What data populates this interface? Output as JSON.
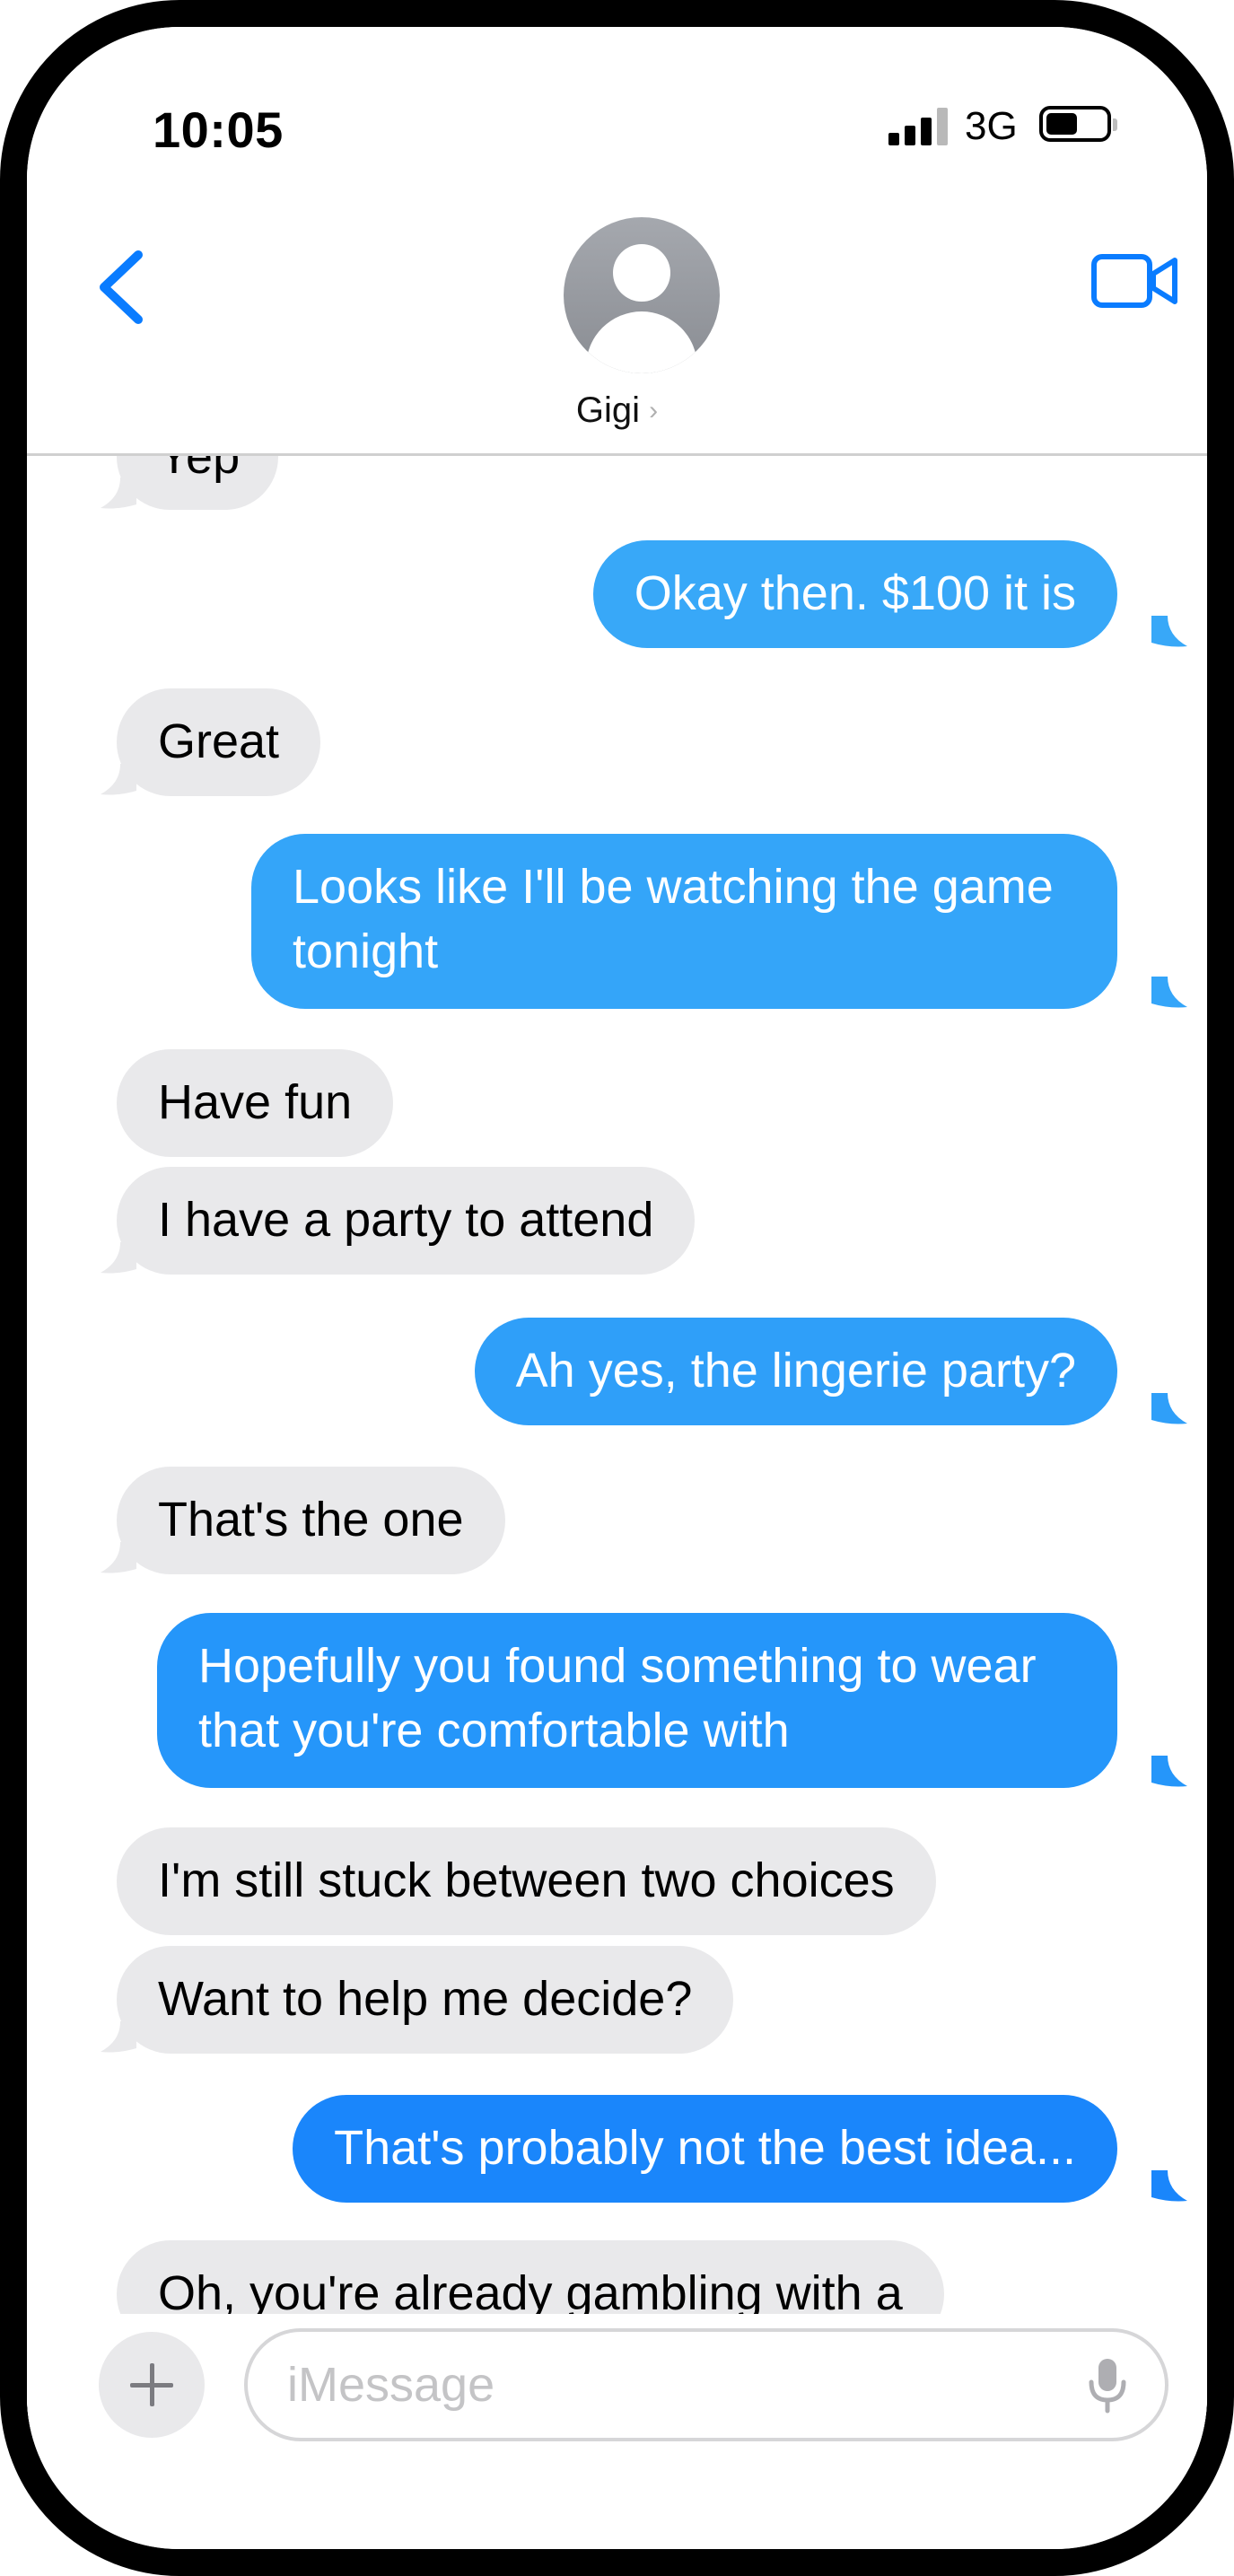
{
  "status_bar": {
    "time": "10:05",
    "network": "3G"
  },
  "header": {
    "contact_name": "Gigi",
    "icons": {
      "back": "chevron-left-icon",
      "avatar": "person-avatar-icon",
      "video": "video-camera-icon",
      "name_chevron": "chevron-right-icon"
    }
  },
  "messages": [
    {
      "sender": "them",
      "text": "Yep"
    },
    {
      "sender": "me",
      "text": "Okay then.  $100 it is"
    },
    {
      "sender": "them",
      "text": "Great"
    },
    {
      "sender": "me",
      "text": "Looks like I'll be watching the game tonight"
    },
    {
      "sender": "them",
      "text": "Have fun"
    },
    {
      "sender": "them",
      "text": "I have a party to attend"
    },
    {
      "sender": "me",
      "text": "Ah yes, the lingerie party?"
    },
    {
      "sender": "them",
      "text": "That's the one"
    },
    {
      "sender": "me",
      "text": "Hopefully you found something to wear that you're comfortable with"
    },
    {
      "sender": "them",
      "text": "I'm still stuck between two choices"
    },
    {
      "sender": "them",
      "text": "Want to help me decide?"
    },
    {
      "sender": "me",
      "text": "That's probably not the best idea..."
    },
    {
      "sender": "them",
      "text": "Oh, you're already gambling with a"
    }
  ],
  "composer": {
    "placeholder": "iMessage",
    "value": "",
    "icons": {
      "add": "plus-icon",
      "mic": "microphone-icon"
    }
  },
  "colors": {
    "sent_bubble_top": "#3ba9f8",
    "sent_bubble_bottom": "#1a86fb",
    "received_bubble": "#e9e9eb",
    "accent_blue": "#0a7cff",
    "frame": "#000000"
  }
}
